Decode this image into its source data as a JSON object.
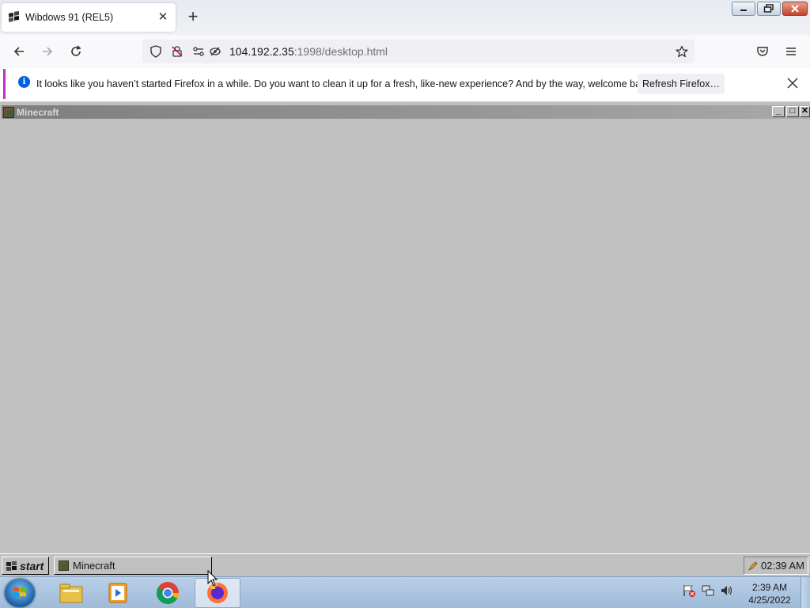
{
  "browser": {
    "tab": {
      "title": "Wibdows 91 (REL5)",
      "close_glyph": "✕"
    },
    "new_tab_glyph": "+",
    "window_controls": {
      "minimize_icon": "minimize-icon",
      "restore_icon": "restore-icon",
      "close_icon": "close-icon"
    },
    "nav": {
      "back_icon": "back-arrow-icon",
      "forward_icon": "forward-arrow-icon",
      "reload_icon": "reload-icon",
      "url_host": "104.192.2.35",
      "url_rest": ":1998/desktop.html",
      "bookmark_icon": "star-icon",
      "pocket_icon": "pocket-icon",
      "menu_icon": "hamburger-menu-icon"
    },
    "notification": {
      "info_glyph": "i",
      "message": "It looks like you haven’t started Firefox in a while. Do you want to clean it up for a fresh, like-new experience? And by the way, welcome back!",
      "button_label": "Refresh Firefox…"
    }
  },
  "wibdows": {
    "window": {
      "title": "Minecraft",
      "minimize_glyph": "_",
      "maximize_glyph": "□",
      "close_glyph": "✕"
    },
    "taskbar": {
      "start_label": "start",
      "task_label": "Minecraft",
      "clock": "02:39 AM"
    }
  },
  "win7_taskbar": {
    "apps": [
      "file-explorer",
      "media-player",
      "chrome",
      "firefox"
    ],
    "active_app": "firefox",
    "clock_time": "2:39 AM",
    "clock_date": "4/25/2022"
  },
  "colors": {
    "desktop_gray": "#c0c0c0",
    "notification_accent": "#b834c9",
    "info_blue": "#0060df"
  }
}
